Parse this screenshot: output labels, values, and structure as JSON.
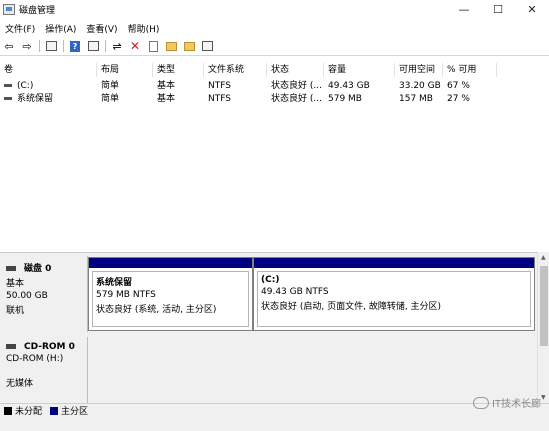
{
  "window": {
    "title": "磁盘管理",
    "buttons": {
      "minimize": "—",
      "maximize": "☐",
      "close": "✕"
    }
  },
  "menu": [
    "文件(F)",
    "操作(A)",
    "查看(V)",
    "帮助(H)"
  ],
  "toolbar": {
    "icons": [
      "back-icon",
      "forward-icon",
      "console-tree-icon",
      "help-icon",
      "properties-icon",
      "connect-icon",
      "delete-icon",
      "check-icon",
      "import-icon",
      "folder-icon",
      "view-icon"
    ]
  },
  "volumes": {
    "columns": [
      "卷",
      "布局",
      "类型",
      "文件系统",
      "状态",
      "容量",
      "可用空间",
      "% 可用"
    ],
    "rows": [
      [
        "(C:)",
        "简单",
        "基本",
        "NTFS",
        "状态良好 (...",
        "49.43 GB",
        "33.20 GB",
        "67 %"
      ],
      [
        "系统保留",
        "简单",
        "基本",
        "NTFS",
        "状态良好 (...",
        "579 MB",
        "157 MB",
        "27 %"
      ]
    ]
  },
  "disks": [
    {
      "title": "磁盘 0",
      "type": "基本",
      "size": "50.00 GB",
      "status": "联机",
      "partitions": [
        {
          "name": "系统保留",
          "size_fs": "579 MB NTFS",
          "status": "状态良好 (系统, 活动, 主分区)"
        },
        {
          "name": "(C:)",
          "size_fs": "49.43 GB NTFS",
          "status": "状态良好 (启动, 页面文件, 故障转储, 主分区)"
        }
      ]
    },
    {
      "title": "CD-ROM 0",
      "type": "CD-ROM (H:)",
      "status": "无媒体"
    }
  ],
  "legend": [
    {
      "label": "未分配",
      "color": "#000000"
    },
    {
      "label": "主分区",
      "color": "#000080"
    }
  ],
  "watermark": "IT技术长廊"
}
